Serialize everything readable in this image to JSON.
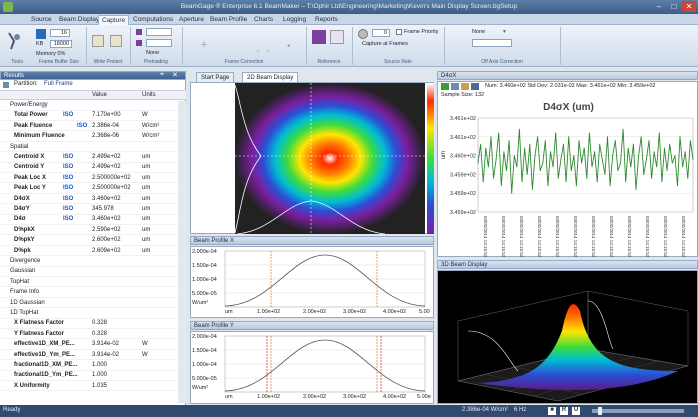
{
  "window": {
    "title": "BeamGage ® Enterprise 6.1 BeamMaker – T:\\Ophir Ltd\\Engineering\\Marketing\\Kevin's Main Display Screen.bgSetup",
    "min": "–",
    "max": "□",
    "close": "✕"
  },
  "menu": [
    "Source",
    "Beam Display",
    "Capture",
    "Computations",
    "Aperture",
    "Beam Profile",
    "Charts",
    "Logging",
    "Reports"
  ],
  "menu_active": "Capture",
  "ribbon": {
    "buffer_value": "16",
    "kb_label": "KB",
    "kb_value": "18000",
    "memory_label": "Memory 0%",
    "frame_label": "Frame",
    "capture_label": "Capture at Frames",
    "priority_label": "Frame Priority",
    "none1": "None",
    "none2": "None",
    "frame_count": "0",
    "groups": [
      "Tools",
      "Frame Buffer Size",
      "Write Protect",
      "Preloading",
      "Frame Correction",
      "Reference",
      "Source Rate",
      "Off Axis Correction"
    ]
  },
  "results": {
    "title": "Results",
    "partition_label": "Partition:",
    "partition_value": "Full Frame",
    "col_name": "",
    "col_value": "Value",
    "col_units": "Units",
    "rows": [
      {
        "kind": "sec",
        "name": "Power/Energy",
        "value": "",
        "units": ""
      },
      {
        "kind": "b",
        "name": "Total Power",
        "iso": "ISO",
        "value": "7.170e+00",
        "units": "W"
      },
      {
        "kind": "b",
        "name": "Peak Fluence",
        "iso": "ISO",
        "value": "2.386e-04",
        "units": "W/cm²"
      },
      {
        "kind": "b",
        "name": "Minimum Fluence",
        "iso": "",
        "value": "2.368e-06",
        "units": "W/cm²"
      },
      {
        "kind": "sec",
        "name": "Spatial",
        "value": "",
        "units": ""
      },
      {
        "kind": "b",
        "name": "Centroid X",
        "iso": "ISO",
        "value": "2.499e+02",
        "units": "um"
      },
      {
        "kind": "b",
        "name": "Centroid Y",
        "iso": "ISO",
        "value": "2.499e+02",
        "units": "um"
      },
      {
        "kind": "b",
        "name": "Peak Loc X",
        "iso": "ISO",
        "value": "2.500000e+02",
        "units": "um"
      },
      {
        "kind": "b",
        "name": "Peak Loc Y",
        "iso": "ISO",
        "value": "2.500000e+02",
        "units": "um"
      },
      {
        "kind": "b",
        "name": "D4σX",
        "iso": "ISO",
        "value": "3.460e+02",
        "units": "um"
      },
      {
        "kind": "b",
        "name": "D4σY",
        "iso": "ISO",
        "value": "345.978",
        "units": "um"
      },
      {
        "kind": "b",
        "name": "D4σ",
        "iso": "ISO",
        "value": "3.460e+02",
        "units": "um"
      },
      {
        "kind": "b",
        "name": "D%pkX",
        "iso": "",
        "value": "2.590e+02",
        "units": "um"
      },
      {
        "kind": "b",
        "name": "D%pkY",
        "iso": "",
        "value": "2.600e+02",
        "units": "um"
      },
      {
        "kind": "b",
        "name": "D%pk",
        "iso": "",
        "value": "2.609e+02",
        "units": "um"
      },
      {
        "kind": "sub",
        "name": "Divergence",
        "value": "",
        "units": ""
      },
      {
        "kind": "sub",
        "name": "Gaussian",
        "value": "",
        "units": ""
      },
      {
        "kind": "sub",
        "name": "TopHat",
        "value": "",
        "units": ""
      },
      {
        "kind": "sub",
        "name": "Frame Info",
        "value": "",
        "units": ""
      },
      {
        "kind": "sub",
        "name": "1D Gaussian",
        "value": "",
        "units": ""
      },
      {
        "kind": "sec",
        "name": "1D TopHat",
        "value": "",
        "units": ""
      },
      {
        "kind": "b",
        "name": "X Flatness Factor",
        "iso": "",
        "value": "0.328",
        "units": ""
      },
      {
        "kind": "b",
        "name": "Y Flatness Factor",
        "iso": "",
        "value": "0.328",
        "units": ""
      },
      {
        "kind": "b",
        "name": "effective1D_XM_PE...",
        "iso": "",
        "value": "3.914e-02",
        "units": "W"
      },
      {
        "kind": "b",
        "name": "effective1D_Ym_PE...",
        "iso": "",
        "value": "3.914e-02",
        "units": "W"
      },
      {
        "kind": "b",
        "name": "fractional1D_XM_PE...",
        "iso": "",
        "value": "1.000",
        "units": ""
      },
      {
        "kind": "b",
        "name": "fractional1D_Ym_PE...",
        "iso": "",
        "value": "1.000",
        "units": ""
      },
      {
        "kind": "b",
        "name": "X Uniformity",
        "iso": "",
        "value": "1.035",
        "units": ""
      }
    ]
  },
  "tabs": {
    "start": "Start Page",
    "display": "2D Beam Display"
  },
  "beam_profile_x": {
    "title": "Beam Profile X",
    "yticks": [
      "2.000e-04",
      "1.500e-04",
      "1.000e-04",
      "5.000e-05",
      "W/um²"
    ],
    "xticks": [
      "um",
      "1.00e+02",
      "2.00e+02",
      "3.00e+02",
      "4.00e+02",
      "5.00"
    ]
  },
  "beam_profile_y": {
    "title": "Beam Profile Y",
    "yticks": [
      "2.000e-04",
      "1.500e-04",
      "1.000e-04",
      "5.000e-05",
      "W/um²"
    ],
    "xticks": [
      "um",
      "1.00e+02",
      "2.00e+02",
      "3.00e+02",
      "4.00e+02",
      "5.00e"
    ]
  },
  "d4sx_panel": {
    "title": "D4σX",
    "stats": "Num: 3.460e+02   Std Dev: 2.031e-02   Max: 3.461e+02   Min: 3.459e+02",
    "sample": "Sample Size: 132",
    "plot_title": "D4σX (um)",
    "ylabel": "um",
    "date_label": "03/02/2014 14:15:52"
  },
  "chart_data": {
    "type": "line",
    "title": "D4σX (um)",
    "ylabel": "um",
    "ylim": [
      345.85,
      346.1
    ],
    "yticks": [
      346.1,
      346.05,
      346.0,
      345.95,
      345.9,
      345.85
    ],
    "values": [
      345.98,
      346.03,
      345.93,
      346.02,
      345.97,
      346.05,
      345.94,
      345.99,
      346.06,
      345.92,
      346.01,
      345.96,
      346.04,
      345.9,
      346.0,
      345.97,
      346.07,
      345.93,
      346.02,
      345.95,
      346.03,
      345.91,
      346.0,
      346.05,
      345.96,
      345.98,
      346.04,
      345.92,
      346.01,
      345.97,
      346.06,
      345.94,
      345.99,
      346.03,
      345.93,
      346.05,
      345.96,
      346.0,
      345.92,
      346.04,
      345.98,
      346.02,
      345.94,
      346.06,
      345.97,
      346.01,
      345.93,
      346.03,
      345.99,
      345.95,
      346.05,
      345.92,
      346.0,
      346.04,
      345.96,
      345.98,
      346.07,
      345.93,
      346.02,
      345.97,
      346.03,
      345.91,
      346.0,
      346.05,
      345.95,
      345.99,
      346.04,
      345.94,
      346.01,
      345.97,
      346.06,
      345.93,
      346.02,
      345.96,
      346.03,
      345.98,
      346.0,
      345.92,
      346.05,
      345.97,
      346.01,
      345.94,
      346.04,
      345.99
    ],
    "line_color": "#2f8a2f"
  },
  "beam3d_panel": {
    "title": "3D Beam Display"
  },
  "status": {
    "left": "Ready",
    "reading": "2.386e-04 W/cm²",
    "rate": "6 Hz"
  }
}
